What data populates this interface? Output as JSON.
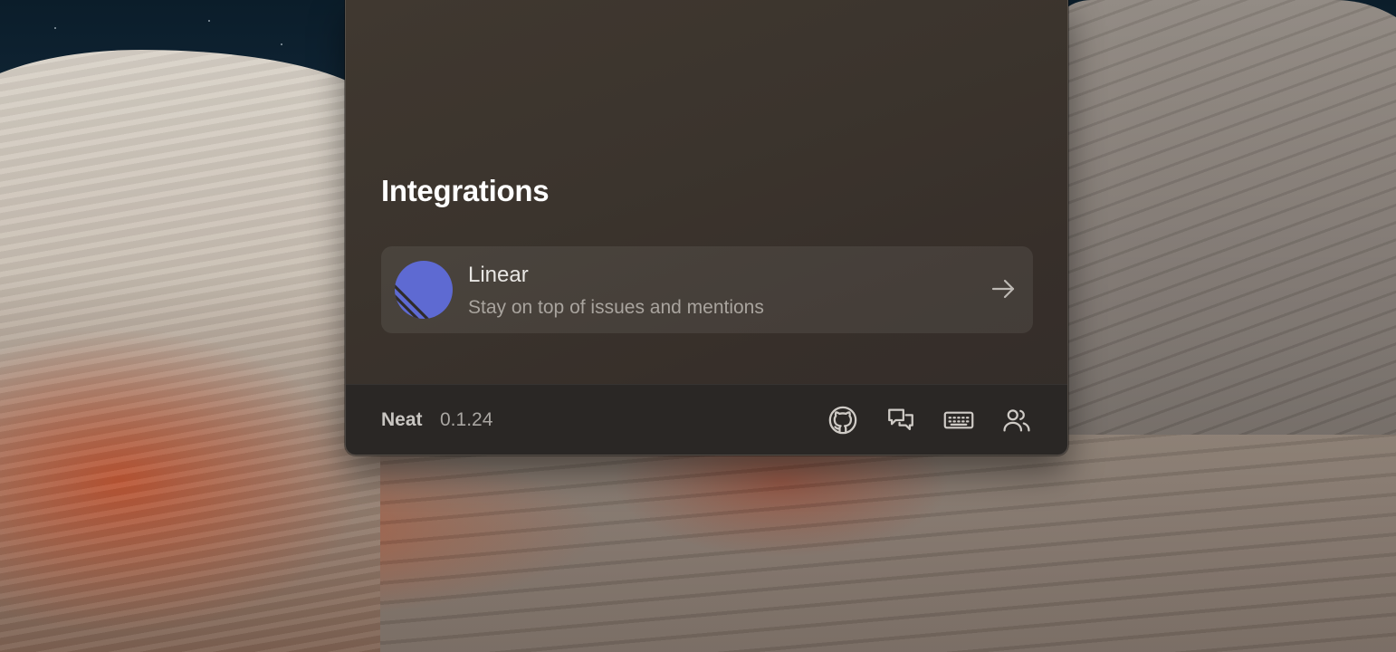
{
  "integrations": {
    "title": "Integrations",
    "items": [
      {
        "name": "Linear",
        "description": "Stay on top of issues and mentions",
        "logo_icon": "linear-logo-icon",
        "action_icon": "arrow-right-icon",
        "brand_color": "#5E6AD2"
      }
    ]
  },
  "footer": {
    "app_name": "Neat",
    "version": "0.1.24",
    "icons": [
      "github-icon",
      "chat-bubbles-icon",
      "keyboard-icon",
      "users-icon"
    ]
  },
  "colors": {
    "window_bg": "#3b342d",
    "footer_bg": "#2a2725",
    "card_bg": "rgba(255,255,255,0.075)",
    "title_text": "#ffffff",
    "secondary_text": "#a9a49e"
  }
}
